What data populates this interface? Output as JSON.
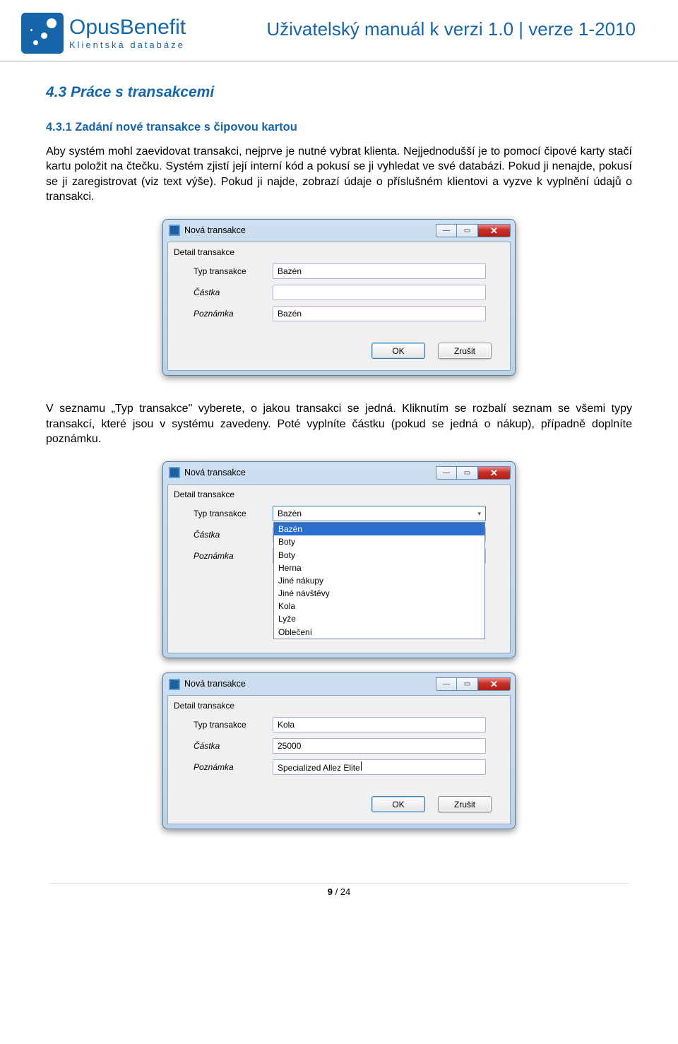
{
  "header": {
    "logo_title": "OpusBenefit",
    "logo_sub": "Klientská databáze",
    "doc_title": "Uživatelský manuál k verzi 1.0 | verze 1-2010"
  },
  "section": {
    "h2": "4.3 Práce s transakcemi",
    "h3": "4.3.1 Zadání nové transakce s čipovou kartou",
    "para1": "Aby systém mohl zaevidovat transakci, nejprve je nutné vybrat klienta. Nejjednodušší je to pomocí čipové karty stačí kartu položit na čtečku. Systém zjistí její interní kód a pokusí se ji vyhledat ve své databázi. Pokud ji nenajde, pokusí se ji zaregistrovat (viz text výše). Pokud ji najde, zobrazí údaje o příslušném klientovi a vyzve k vyplnění údajů o transakci.",
    "para2": "V seznamu „Typ transakce\" vyberete, o jakou transakci se jedná. Kliknutím se rozbalí seznam se všemi typy transakcí, které jsou v systému zavedeny. Poté vyplníte částku (pokud se jedná o nákup), případně doplníte poznámku."
  },
  "dialog": {
    "window_title": "Nová transakce",
    "group_label": "Detail transakce",
    "labels": {
      "type": "Typ transakce",
      "amount": "Částka",
      "note": "Poznámka"
    },
    "buttons": {
      "ok": "OK",
      "cancel": "Zrušit"
    }
  },
  "dlg1": {
    "type": "Bazén",
    "amount": "",
    "note": "Bazén"
  },
  "dlg2": {
    "type": "Bazén",
    "options": [
      "Bazén",
      "Boty",
      "Boty",
      "Herna",
      "Jiné nákupy",
      "Jiné návštěvy",
      "Kola",
      "Lyže",
      "Oblečení"
    ],
    "selected_index": 0
  },
  "dlg3": {
    "type": "Kola",
    "amount": "25000",
    "note": "Specialized Allez Elite"
  },
  "footer": {
    "page_num": "9",
    "page_sep": " / ",
    "page_total": "24"
  }
}
